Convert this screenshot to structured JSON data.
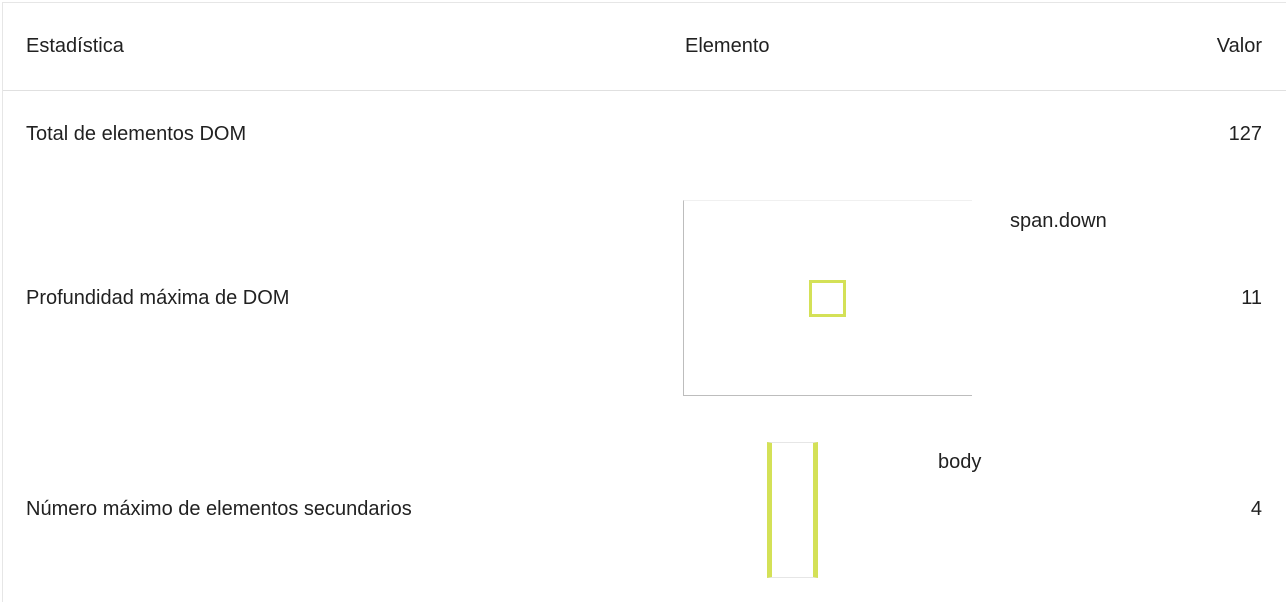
{
  "table": {
    "headers": {
      "statistic": "Estadística",
      "element": "Elemento",
      "value": "Valor"
    },
    "rows": [
      {
        "statistic": "Total de elementos DOM",
        "element": "",
        "value": "127"
      },
      {
        "statistic": "Profundidad máxima de DOM",
        "element": "span.down",
        "value": "11"
      },
      {
        "statistic": "Número máximo de elementos secundarios",
        "element": "body",
        "value": "4"
      }
    ]
  },
  "colors": {
    "highlight": "#d4e157",
    "text": "#212121",
    "divider": "#e0e0e0"
  }
}
